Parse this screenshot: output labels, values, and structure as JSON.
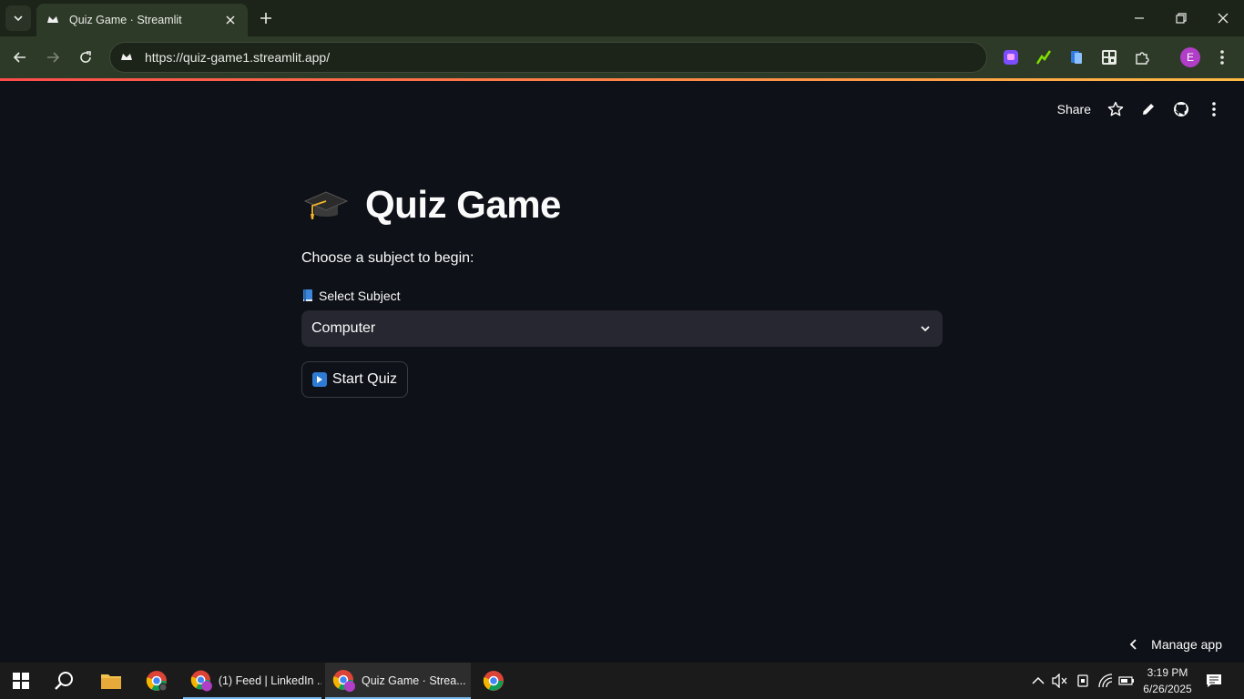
{
  "browser": {
    "tab_title": "Quiz Game · Streamlit",
    "url": "https://quiz-game1.streamlit.app/",
    "profile_initial": "E"
  },
  "app_header": {
    "share_label": "Share"
  },
  "main": {
    "title": "Quiz Game",
    "title_icon": "graduation-cap-emoji",
    "subtitle": "Choose a subject to begin:",
    "select_label": "Select Subject",
    "select_label_icon": "blue-book-emoji",
    "select_value": "Computer",
    "start_button_label": "Start Quiz",
    "start_button_icon": "play-button-emoji"
  },
  "manage_app_label": "Manage app",
  "taskbar": {
    "apps": [
      {
        "label": "(1) Feed | LinkedIn ..."
      },
      {
        "label": "Quiz Game · Strea..."
      }
    ],
    "time": "3:19 PM",
    "date": "6/26/2025"
  },
  "colors": {
    "background": "#0e1117",
    "select_bg": "#262730",
    "accent_gradient_start": "#ff4b4b",
    "accent_gradient_end": "#ffbd45"
  }
}
